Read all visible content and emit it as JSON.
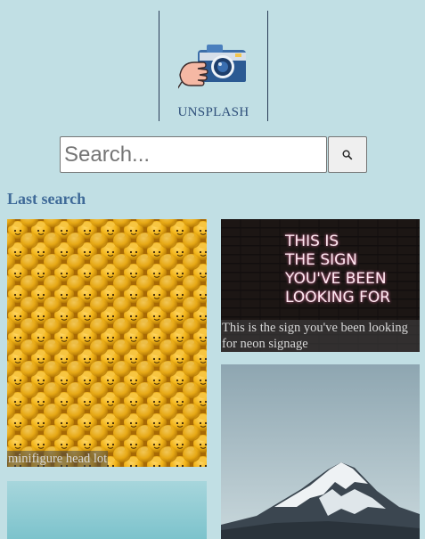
{
  "brand": {
    "name": "UNSPLASH",
    "logo_icon": "camera-hand-icon"
  },
  "search": {
    "placeholder": "Search...",
    "value": "",
    "button_icon": "magnifier-icon"
  },
  "section": {
    "title": "Last search"
  },
  "photos": [
    {
      "caption": "minifigure head lot",
      "subject": "yellow-lego-heads"
    },
    {
      "caption": "This is the sign you've been looking for neon signage",
      "subject": "neon-sign"
    },
    {
      "caption": "",
      "subject": "snowy-mountain"
    },
    {
      "caption": "",
      "subject": "sky-sea"
    }
  ],
  "neon_text": [
    "THIS IS",
    "THE SIGN",
    "YOU'VE BEEN",
    "LOOKING FOR"
  ],
  "colors": {
    "background": "#c1dfe4",
    "title": "#3f6a98",
    "brand_text": "#2e4f7a"
  }
}
